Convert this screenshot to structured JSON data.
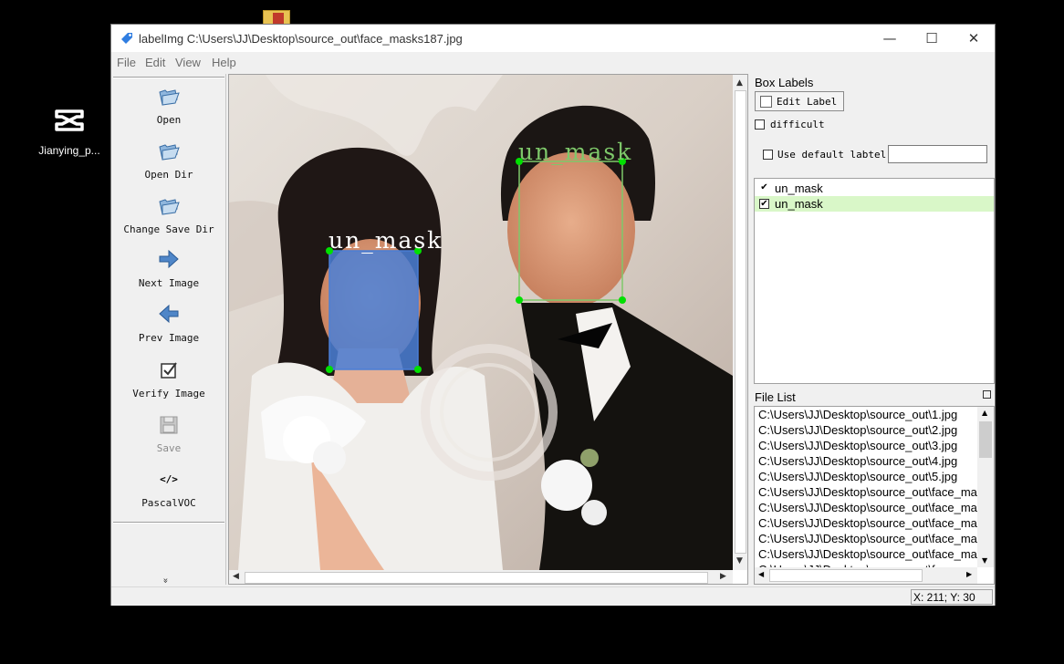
{
  "desktop": {
    "app_shortcut_label": "Jianying_p..."
  },
  "window": {
    "title": "labelImg C:\\Users\\JJ\\Desktop\\source_out\\face_masks187.jpg",
    "minimize": "—",
    "maximize": "☐",
    "close": "✕"
  },
  "menu": {
    "file": "File",
    "edit": "Edit",
    "view": "View",
    "help": "Help"
  },
  "toolbar": {
    "open": "Open",
    "open_dir": "Open Dir",
    "change_save_dir": "Change Save Dir",
    "next_image": "Next Image",
    "prev_image": "Prev Image",
    "verify_image": "Verify Image",
    "save": "Save",
    "format": "PascalVOC",
    "format_icon": "</>",
    "more": "»"
  },
  "canvas": {
    "boxes": [
      {
        "label": "un_mask",
        "color": "#4a7fd6"
      },
      {
        "label": "un_mask",
        "color": "#7ec86a"
      }
    ]
  },
  "box_labels": {
    "title": "Box Labels",
    "edit_label_button": "Edit Label",
    "difficult": "difficult",
    "use_default_label": "Use default labtel",
    "default_label_value": "",
    "items": [
      {
        "label": "un_mask",
        "checked": true,
        "selected": false
      },
      {
        "label": "un_mask",
        "checked": true,
        "selected": true
      }
    ]
  },
  "file_list": {
    "title": "File List",
    "items": [
      "C:\\Users\\JJ\\Desktop\\source_out\\1.jpg",
      "C:\\Users\\JJ\\Desktop\\source_out\\2.jpg",
      "C:\\Users\\JJ\\Desktop\\source_out\\3.jpg",
      "C:\\Users\\JJ\\Desktop\\source_out\\4.jpg",
      "C:\\Users\\JJ\\Desktop\\source_out\\5.jpg",
      "C:\\Users\\JJ\\Desktop\\source_out\\face_mas",
      "C:\\Users\\JJ\\Desktop\\source_out\\face_mas",
      "C:\\Users\\JJ\\Desktop\\source_out\\face_mas",
      "C:\\Users\\JJ\\Desktop\\source_out\\face_mas",
      "C:\\Users\\JJ\\Desktop\\source_out\\face_mas",
      "C:\\Users\\JJ\\Desktop\\source_out\\f"
    ]
  },
  "status": {
    "coords": "X: 211; Y: 30"
  },
  "colors": {
    "selected_row": "#d9f7c8",
    "box_blue": "#4a7fd6",
    "box_green": "#7ec86a",
    "vertex": "#00e000"
  }
}
